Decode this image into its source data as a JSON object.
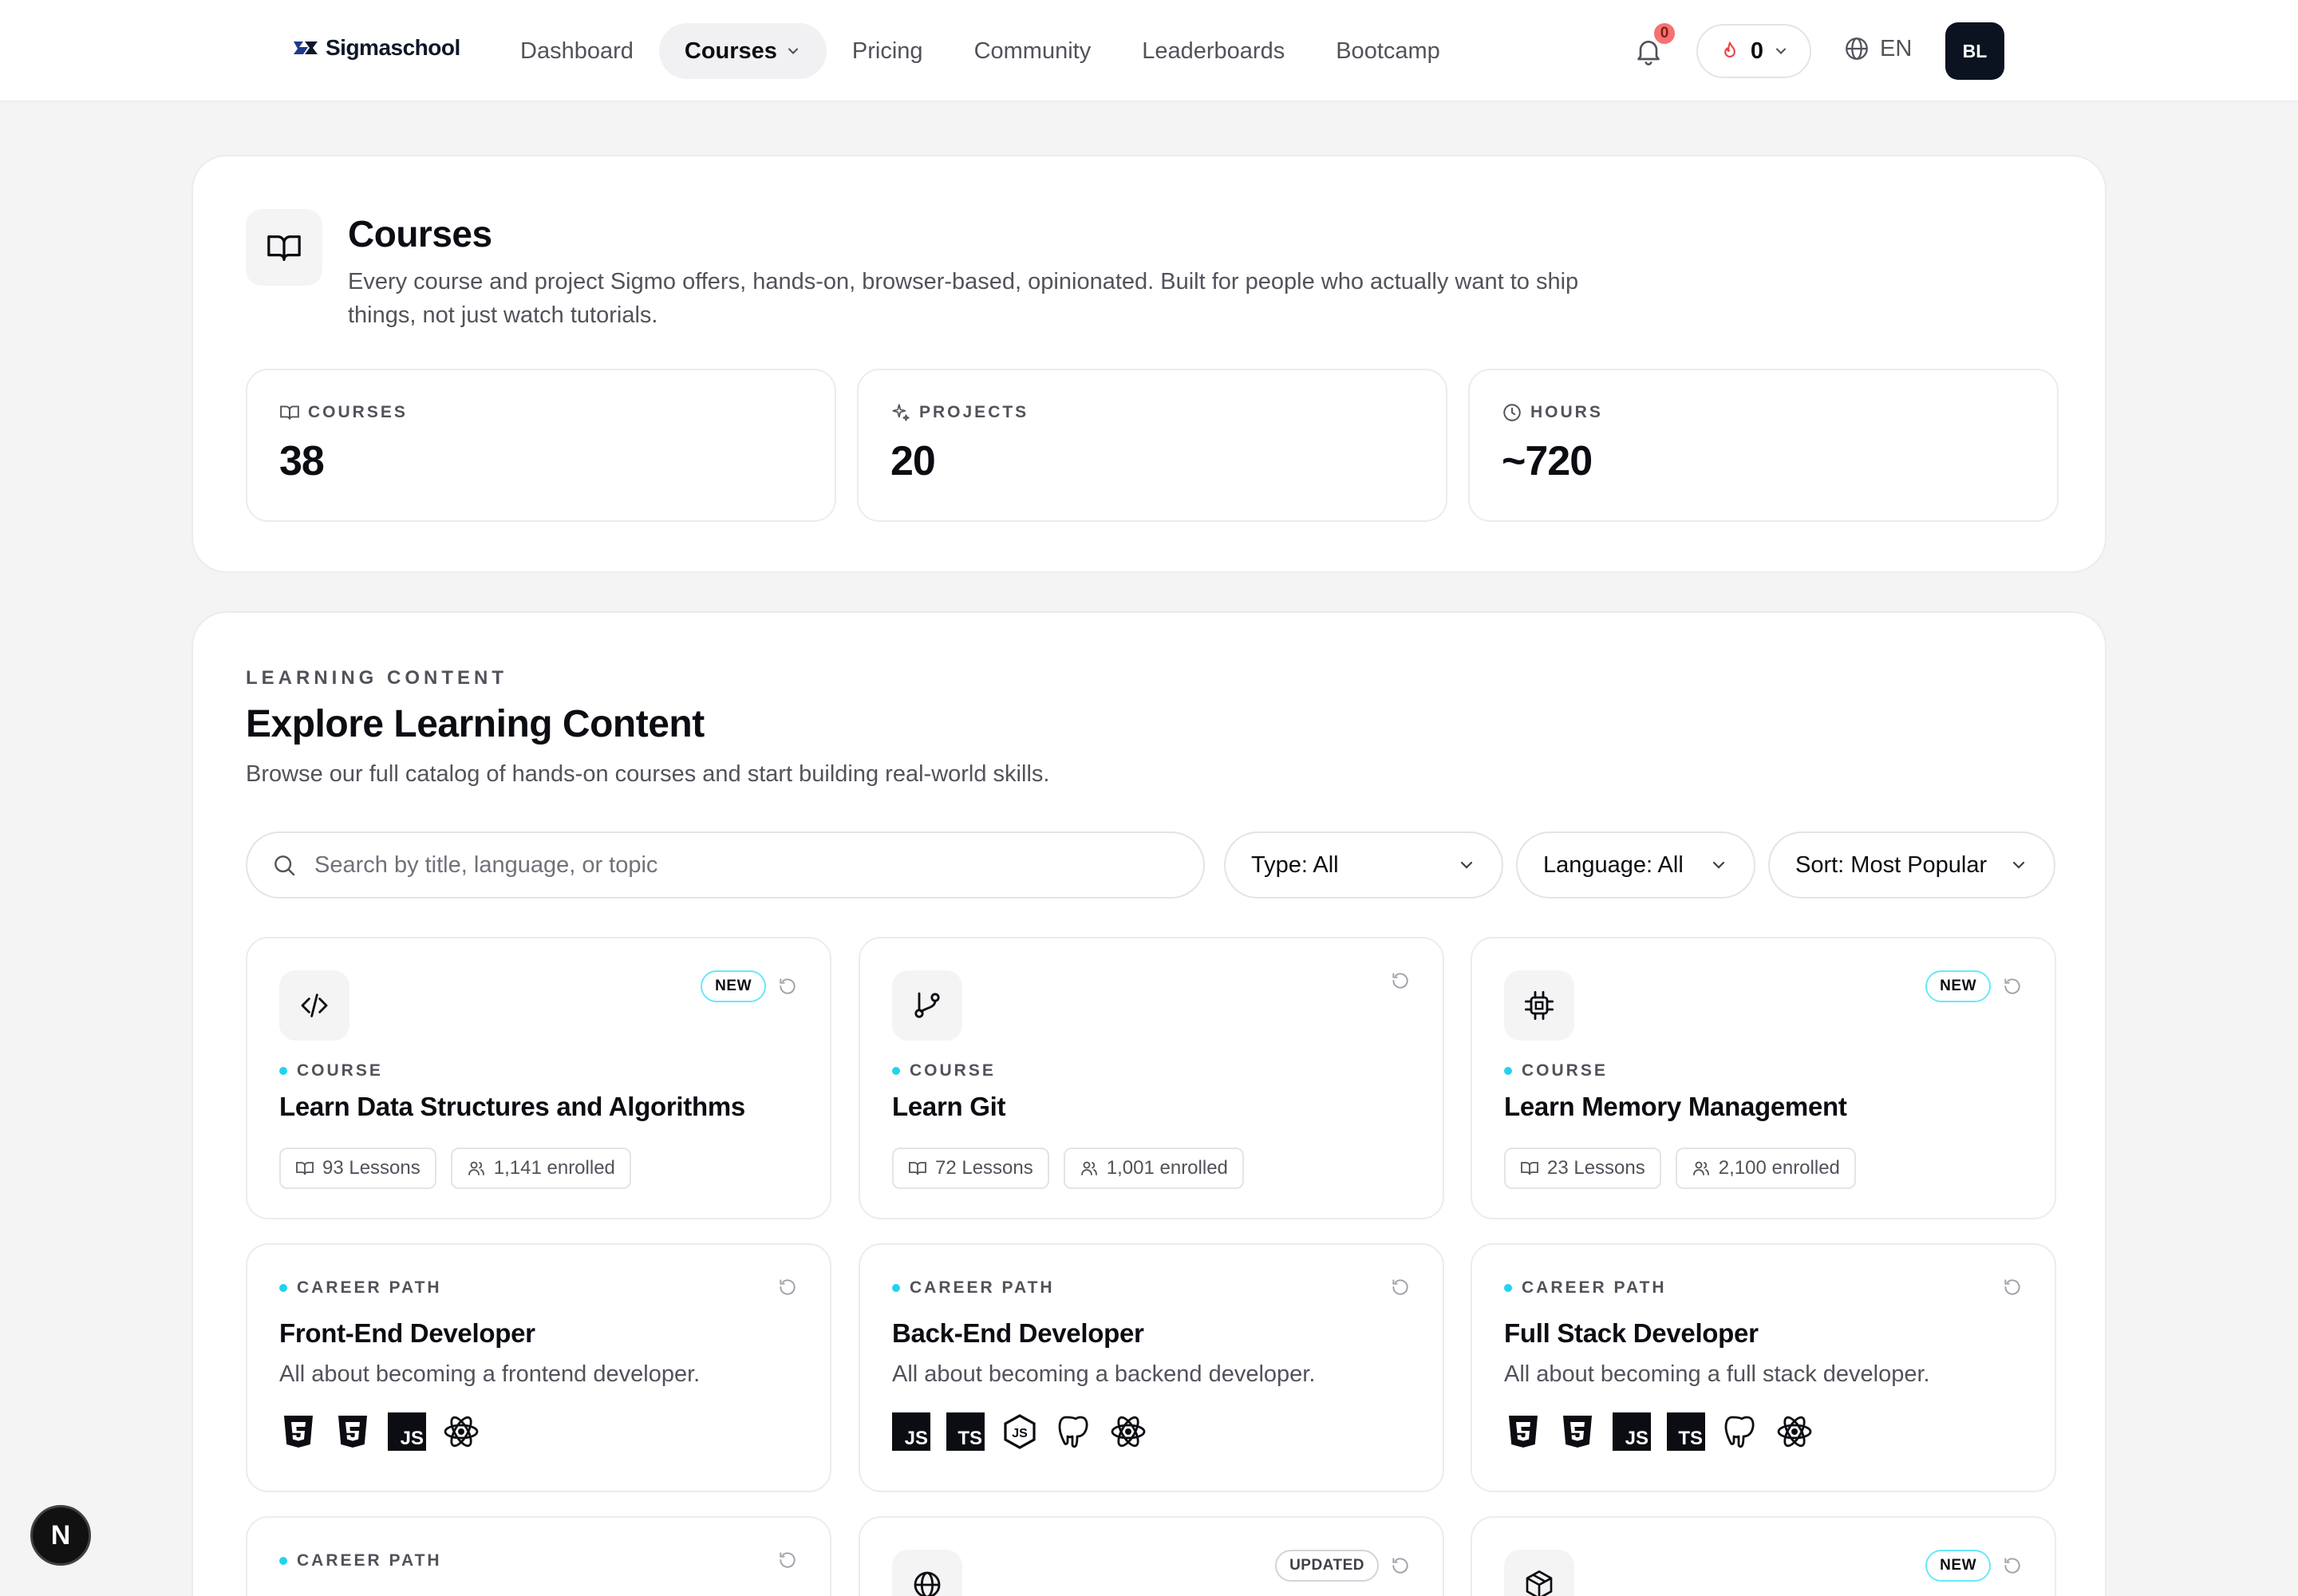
{
  "brand": {
    "name": "Sigmaschool"
  },
  "nav": {
    "links": [
      "Dashboard",
      "Courses",
      "Pricing",
      "Community",
      "Leaderboards",
      "Bootcamp"
    ],
    "notification_count": "0",
    "streak_count": "0",
    "language": "EN",
    "avatar_initials": "BL"
  },
  "hero": {
    "title": "Courses",
    "description": "Every course and project Sigmo offers, hands-on, browser-based, opinionated. Built for people who actually want to ship things, not just watch tutorials.",
    "stats": [
      {
        "label": "COURSES",
        "value": "38",
        "icon": "book-icon"
      },
      {
        "label": "PROJECTS",
        "value": "20",
        "icon": "sparkles-icon"
      },
      {
        "label": "HOURS",
        "value": "~720",
        "icon": "clock-icon"
      }
    ]
  },
  "learn": {
    "eyebrow": "LEARNING CONTENT",
    "title": "Explore Learning Content",
    "description": "Browse our full catalog of hands-on courses and start building real-world skills.",
    "search_placeholder": "Search by title, language, or topic",
    "filters": {
      "type": "Type: All",
      "language": "Language: All",
      "sort": "Sort: Most Popular"
    },
    "cards": [
      {
        "type": "COURSE",
        "title": "Learn Data Structures and Algorithms",
        "badge": "NEW",
        "lessons": "93 Lessons",
        "enrolled": "1,141 enrolled",
        "icon": "code-icon"
      },
      {
        "type": "COURSE",
        "title": "Learn Git",
        "badge": "",
        "lessons": "72 Lessons",
        "enrolled": "1,001 enrolled",
        "icon": "git-branch-icon"
      },
      {
        "type": "COURSE",
        "title": "Learn Memory Management",
        "badge": "NEW",
        "lessons": "23 Lessons",
        "enrolled": "2,100 enrolled",
        "icon": "cpu-icon"
      },
      {
        "type": "CAREER PATH",
        "title": "Front-End Developer",
        "description": "All about becoming a frontend developer.",
        "techs": [
          "html5",
          "css3",
          "js",
          "react"
        ]
      },
      {
        "type": "CAREER PATH",
        "title": "Back-End Developer",
        "description": "All about becoming a backend developer.",
        "techs": [
          "js",
          "ts",
          "nodejs",
          "postgresql",
          "react"
        ]
      },
      {
        "type": "CAREER PATH",
        "title": "Full Stack Developer",
        "description": "All about becoming a full stack developer.",
        "techs": [
          "html5",
          "css3",
          "js",
          "ts",
          "postgresql",
          "react"
        ]
      },
      {
        "type": "CAREER PATH",
        "badge": ""
      },
      {
        "badge": "UPDATED",
        "icon": "globe-icon"
      },
      {
        "badge": "NEW",
        "icon": "box-icon"
      }
    ]
  },
  "fab": {
    "label": "N"
  },
  "colors": {
    "accent": "#22d3ee",
    "badge_border": "#67e8f9",
    "notification": "#f87171",
    "avatar_bg": "#0b1220"
  }
}
